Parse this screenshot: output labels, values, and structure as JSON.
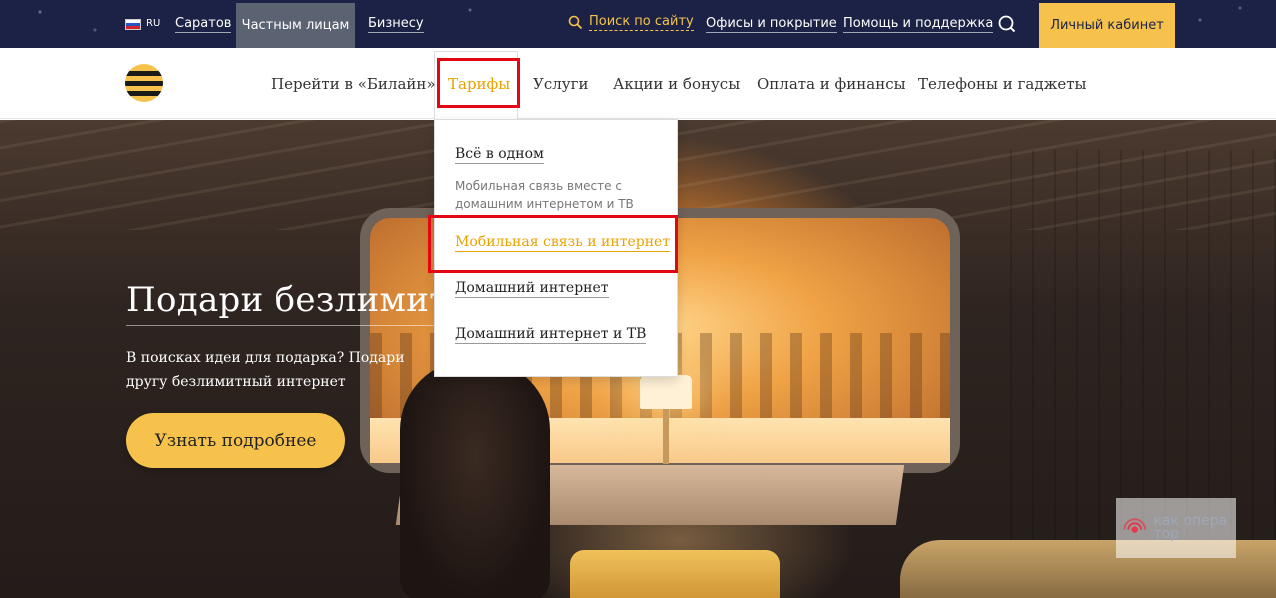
{
  "topbar": {
    "lang": "RU",
    "city": "Саратов",
    "segment_private": "Частным лицам",
    "segment_business": "Бизнесу",
    "search_link": "Поиск по сайту",
    "offices": "Офисы и покрытие",
    "help": "Помощь и поддержка",
    "cabinet": "Личный кабинет"
  },
  "nav": {
    "items": [
      "Перейти в «Билайн»",
      "Тарифы",
      "Услуги",
      "Акции и бонусы",
      "Оплата и финансы",
      "Телефоны и гаджеты"
    ],
    "active": "Тарифы"
  },
  "dropdown": {
    "all_in_one": "Всё в одном",
    "all_in_one_desc": "Мобильная связь вместе с домашним интернетом и ТВ",
    "mobile": "Мобильная связь и интернет",
    "home_internet": "Домашний интернет",
    "home_internet_tv": "Домашний интернет и ТВ"
  },
  "hero": {
    "headline": "Подари безлимит",
    "subtitle": "В поисках идеи для подарка? Подари другу безлимитный интернет",
    "cta": "Узнать подробнее"
  },
  "watermark": {
    "text": "как опера тор"
  },
  "colors": {
    "topbar_bg": "#1b2245",
    "accent": "#f6c24b",
    "active_link": "#e9a200",
    "highlight": "#e30713"
  }
}
